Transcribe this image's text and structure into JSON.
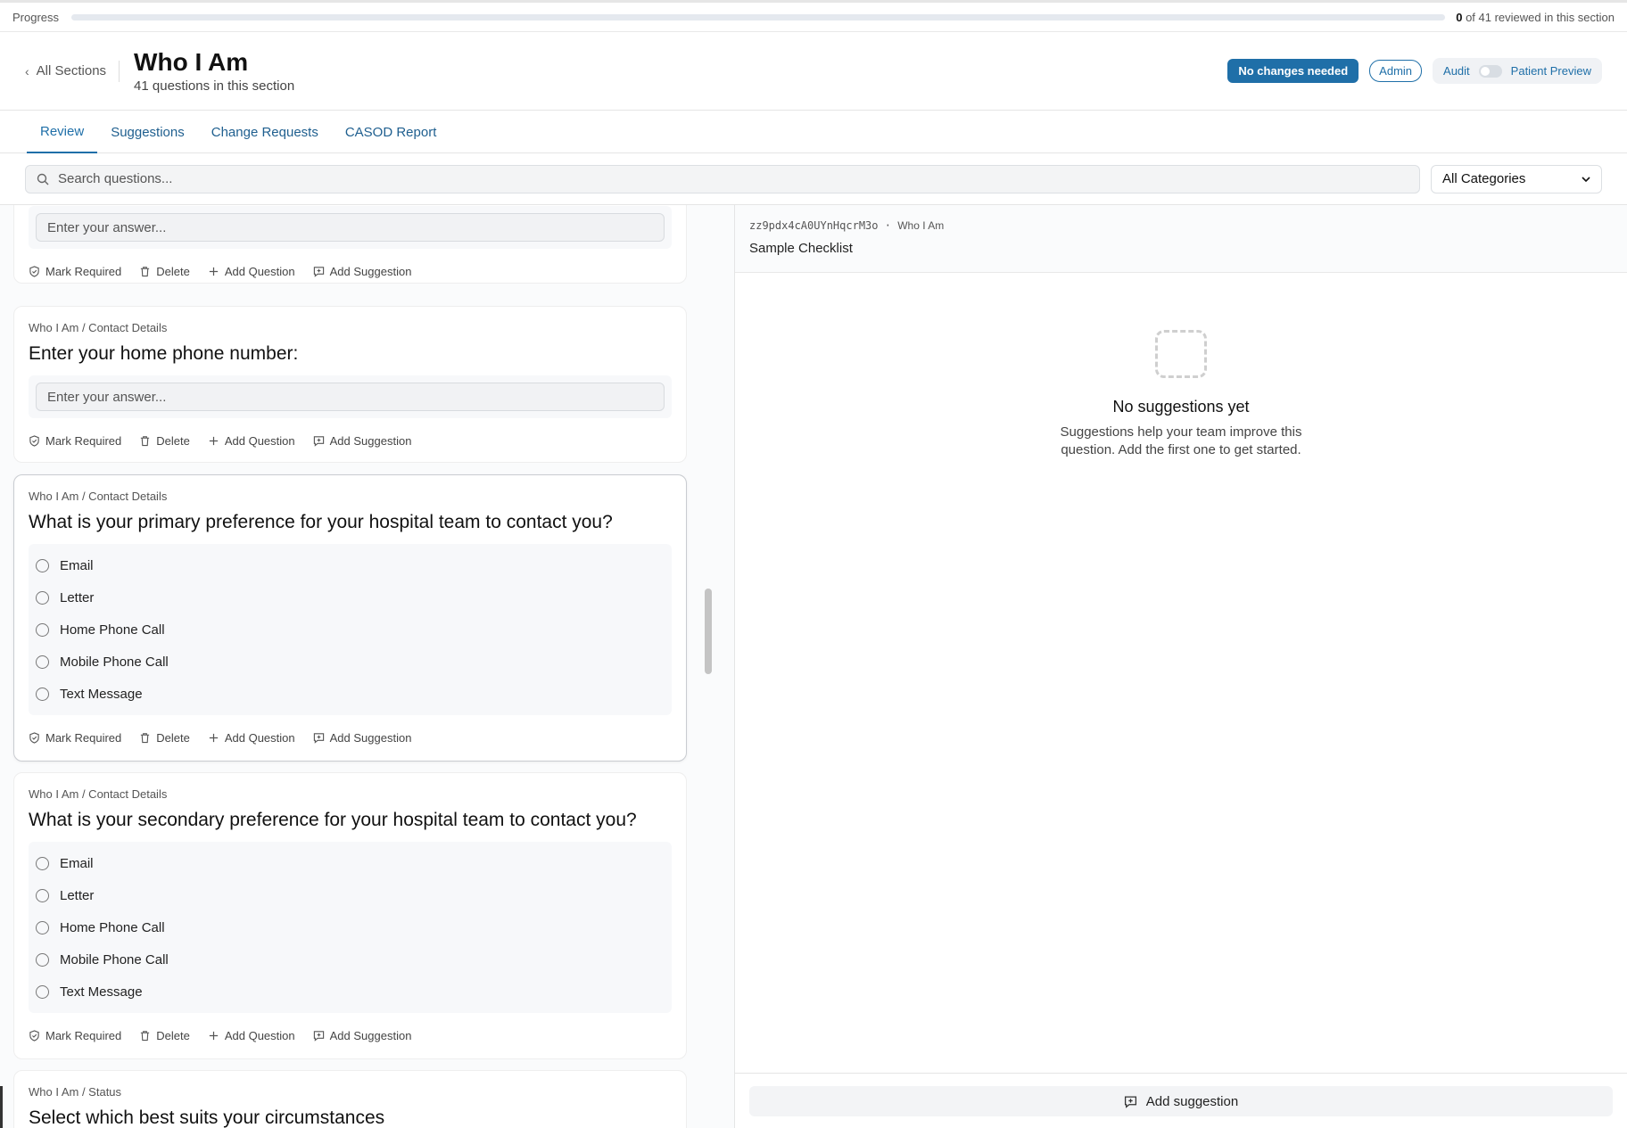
{
  "progress": {
    "label": "Progress",
    "fill_fraction": 0.0,
    "reviewed": "0",
    "rest": " of 41 reviewed in this section"
  },
  "header": {
    "back_label": "All Sections",
    "title": "Who I Am",
    "subtitle": "41 questions in this section",
    "no_changes_label": "No changes needed",
    "admin_label": "Admin",
    "audit_label": "Audit",
    "patient_preview_label": "Patient Preview"
  },
  "tabs": [
    {
      "label": "Review",
      "active": true
    },
    {
      "label": "Suggestions"
    },
    {
      "label": "Change Requests"
    },
    {
      "label": "CASOD Report"
    }
  ],
  "search": {
    "placeholder": "Search questions...",
    "category": "All Categories"
  },
  "actions": {
    "mark_required": "Mark Required",
    "delete": "Delete",
    "add_question": "Add Question",
    "add_suggestion": "Add Suggestion"
  },
  "questions": [
    {
      "answer_placeholder": "Enter your answer..."
    },
    {
      "crumb": "Who I Am / Contact Details",
      "text": "Enter your home phone number:",
      "answer_placeholder": "Enter your answer..."
    },
    {
      "crumb": "Who I Am / Contact Details",
      "text": "What is your primary preference for your hospital team to contact you?",
      "options": [
        "Email",
        "Letter",
        "Home Phone Call",
        "Mobile Phone Call",
        "Text Message"
      ]
    },
    {
      "crumb": "Who I Am / Contact Details",
      "text": "What is your secondary preference for your hospital team to contact you?",
      "options": [
        "Email",
        "Letter",
        "Home Phone Call",
        "Mobile Phone Call",
        "Text Message"
      ]
    },
    {
      "crumb": "Who I Am / Status",
      "text": "Select which best suits your circumstances"
    }
  ],
  "panel": {
    "id": "zz9pdx4cA0UYnHqcrM3o",
    "section": "Who I Am",
    "subtitle": "Sample Checklist",
    "empty_title": "No suggestions yet",
    "empty_line1": "Suggestions help your team improve this",
    "empty_line2": "question. Add the first one to get started.",
    "add_button": "Add suggestion"
  }
}
